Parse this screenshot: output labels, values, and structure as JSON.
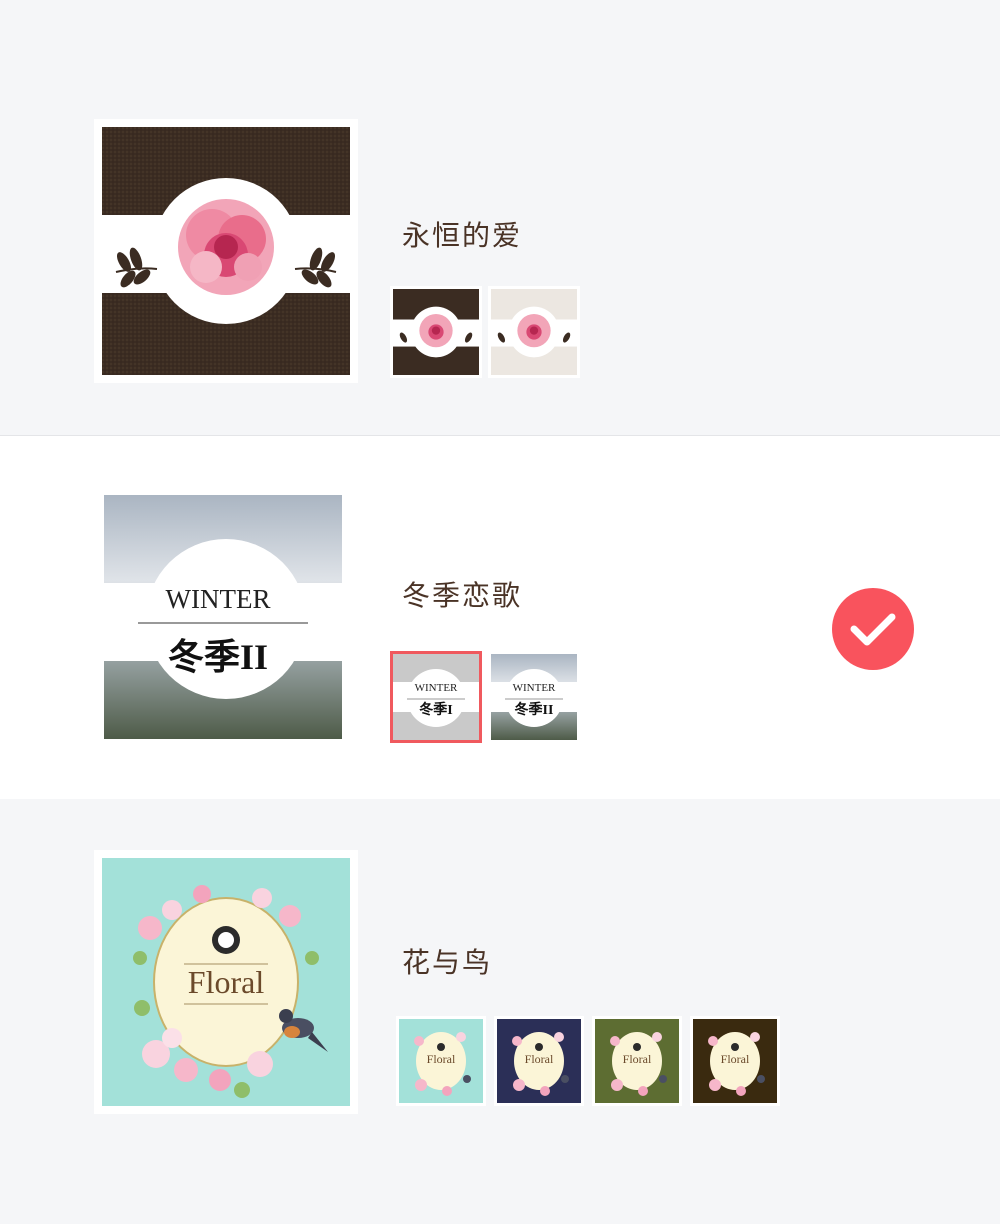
{
  "designs": [
    {
      "title": "永恒的爱",
      "motif": "peony-flower",
      "variants": [
        {
          "name": "dark-brown",
          "bg": "#3b2c22"
        },
        {
          "name": "light-beige",
          "bg": "#ece7e1"
        }
      ],
      "selected_variant": 0
    },
    {
      "title": "冬季恋歌",
      "preview": {
        "top_text": "WINTER",
        "bottom_text": "冬季II"
      },
      "variants": [
        {
          "name": "silver",
          "top_text": "WINTER",
          "bottom_text": "冬季I",
          "bg": "#c9c9c9"
        },
        {
          "name": "photo",
          "top_text": "WINTER",
          "bottom_text": "冬季II",
          "bg": "#8d9aa8"
        }
      ],
      "selected_variant": 0,
      "checked": true
    },
    {
      "title": "花与鸟",
      "preview": {
        "label": "Floral"
      },
      "variants": [
        {
          "name": "mint",
          "label": "Floral",
          "bg": "#a3e1d9"
        },
        {
          "name": "navy",
          "label": "Floral",
          "bg": "#2b2f57"
        },
        {
          "name": "olive",
          "label": "Floral",
          "bg": "#5d6d32"
        },
        {
          "name": "dark-brown",
          "label": "Floral",
          "bg": "#3a2a0f"
        }
      ],
      "selected_variant": 0
    }
  ],
  "colors": {
    "accent": "#f9535d",
    "title_text": "#4a3326",
    "row_alt_bg": "#f5f6f8"
  },
  "icons": {
    "check": "check-icon"
  }
}
